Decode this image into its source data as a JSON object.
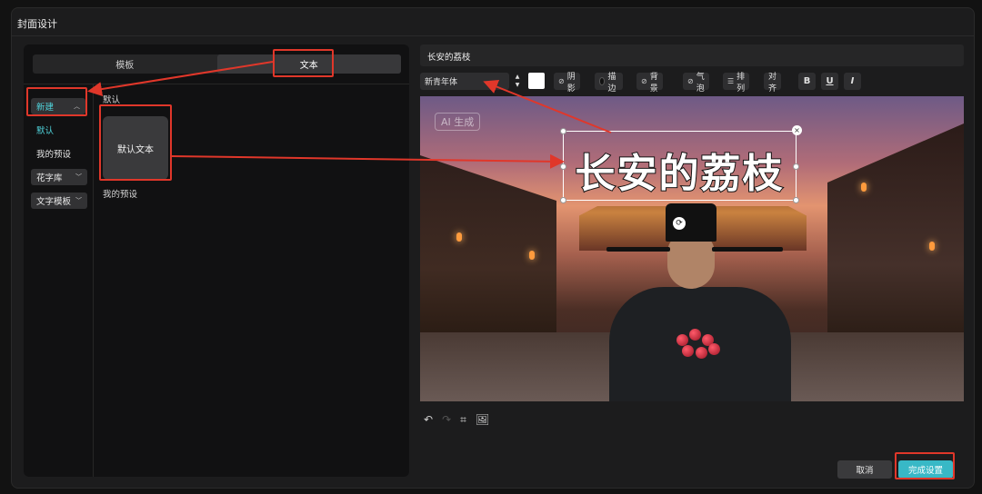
{
  "dialog": {
    "title": "封面设计"
  },
  "left_panel": {
    "tabs": [
      {
        "label": "模板",
        "active": false
      },
      {
        "label": "文本",
        "active": true
      }
    ],
    "categories": {
      "new": {
        "label": "新建",
        "expanded": true
      },
      "default": {
        "label": "默认"
      },
      "my_presets": {
        "label": "我的预设"
      },
      "fancy_text": {
        "label": "花字库"
      },
      "text_templates": {
        "label": "文字模板"
      }
    },
    "groups": {
      "default_label": "默认",
      "my_presets_label": "我的预设"
    },
    "preset_card": {
      "label": "默认文本"
    }
  },
  "editor": {
    "text_layer_name": "长安的荔枝",
    "font": "新青年体",
    "color": "#ffffff",
    "toolbar": {
      "shadow": "阴影",
      "stroke": "描边",
      "background": "背景",
      "bubble": "气泡",
      "arrange": "排列",
      "align": "对齐",
      "bold": "B",
      "underline": "U",
      "italic": "I"
    }
  },
  "canvas": {
    "ai_badge": "AI 生成",
    "cover_text": "长安的荔枝"
  },
  "bottom_tools": {
    "undo": "↶",
    "redo": "↷",
    "crop": "⌗",
    "replace_image": "🖼"
  },
  "footer": {
    "cancel": "取消",
    "done": "完成设置"
  },
  "accent_color": "#38b8c6",
  "annotation_color": "#e0372a"
}
